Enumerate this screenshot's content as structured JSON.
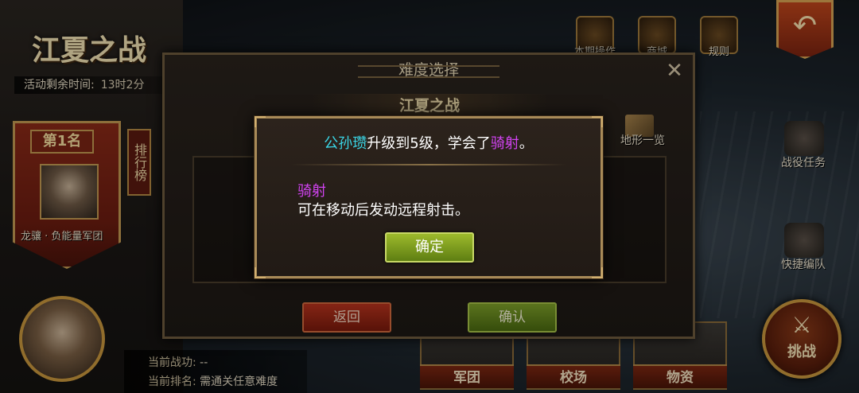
{
  "event": {
    "title": "江夏之战",
    "time_label": "活动剩余时间:",
    "time_value": "13时2分"
  },
  "ranking": {
    "badge": "第1名",
    "player": "龙骧 · 负能量军团",
    "tab": "排行榜"
  },
  "top_icons": [
    {
      "name": "本期操作",
      "icon": "scroll-icon"
    },
    {
      "name": "商城",
      "icon": "shop-icon"
    },
    {
      "name": "规则",
      "icon": "rules-book-icon"
    }
  ],
  "side_menu": [
    {
      "label": "战役任务",
      "icon": "campaign-task-icon"
    },
    {
      "label": "快捷编队",
      "icon": "quick-formation-icon"
    }
  ],
  "fight_button": {
    "label": "挑战",
    "icon": "crossed-swords-icon"
  },
  "bottom_info": {
    "merit_label": "当前战功:",
    "merit_value": "--",
    "rank_label": "当前排名:",
    "rank_value": "需通关任意难度"
  },
  "bottom_tiles": [
    {
      "label": "军团"
    },
    {
      "label": "校场"
    },
    {
      "label": "物资"
    }
  ],
  "difficulty_window": {
    "title": "难度选择",
    "stage": "江夏之战",
    "terrain_label": "地形一览",
    "back_button": "返回",
    "confirm_button": "确认"
  },
  "skill_dialog": {
    "hero": "公孙瓒",
    "text_mid": "升级到5级，学会了",
    "skill": "骑射",
    "text_end": "。",
    "skill_name": "骑射",
    "skill_desc": "可在移动后发动远程射击。",
    "ok_button": "确定"
  },
  "colors": {
    "hero_name": "#3ad6e6",
    "skill_name": "#d243f2",
    "ok_button": "#7ea02a",
    "back_button": "#b8341e"
  }
}
